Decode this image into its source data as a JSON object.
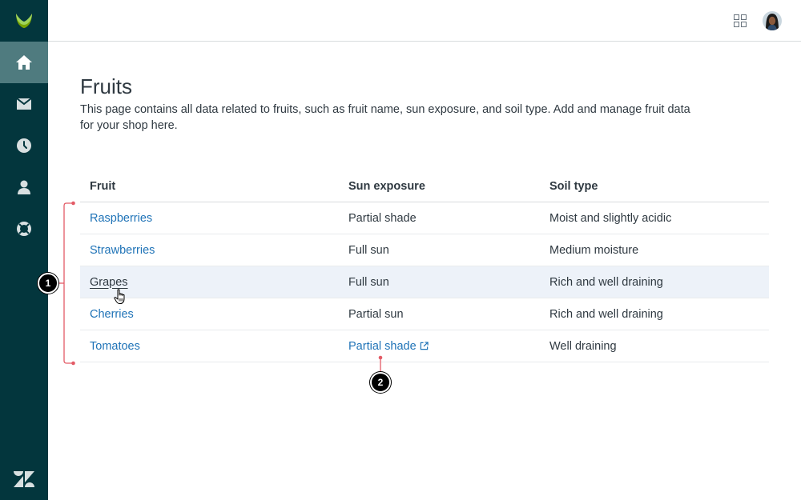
{
  "sidebar": {
    "items": [
      {
        "name": "home",
        "icon": "home-icon",
        "active": true
      },
      {
        "name": "inbox",
        "icon": "mail-icon",
        "active": false
      },
      {
        "name": "history",
        "icon": "clock-icon",
        "active": false
      },
      {
        "name": "user",
        "icon": "person-icon",
        "active": false
      },
      {
        "name": "support",
        "icon": "lifebuoy-icon",
        "active": false
      }
    ]
  },
  "header": {
    "apps_icon": "grid-icon",
    "avatar_icon": "user-avatar"
  },
  "page": {
    "title": "Fruits",
    "description": "This page contains all data related to fruits, such as fruit name, sun exposure, and soil type. Add and manage fruit data for your shop here."
  },
  "table": {
    "headers": [
      "Fruit",
      "Sun exposure",
      "Soil type"
    ],
    "rows": [
      {
        "fruit": "Raspberries",
        "sun": "Partial shade",
        "soil": "Moist and slightly acidic"
      },
      {
        "fruit": "Strawberries",
        "sun": "Full sun",
        "soil": "Medium moisture"
      },
      {
        "fruit": "Grapes",
        "sun": "Full sun",
        "soil": "Rich and well draining"
      },
      {
        "fruit": "Cherries",
        "sun": "Partial sun",
        "soil": "Rich and well draining"
      },
      {
        "fruit": "Tomatoes",
        "sun": "Partial shade",
        "soil": "Well draining"
      }
    ]
  },
  "annotations": {
    "badge1": "1",
    "badge2": "2"
  },
  "colors": {
    "sidebar_bg": "#03363d",
    "sidebar_active": "#4f7b7f",
    "link": "#1f73b7",
    "hover_row": "#edf2f9",
    "annotation": "#e35b66"
  }
}
